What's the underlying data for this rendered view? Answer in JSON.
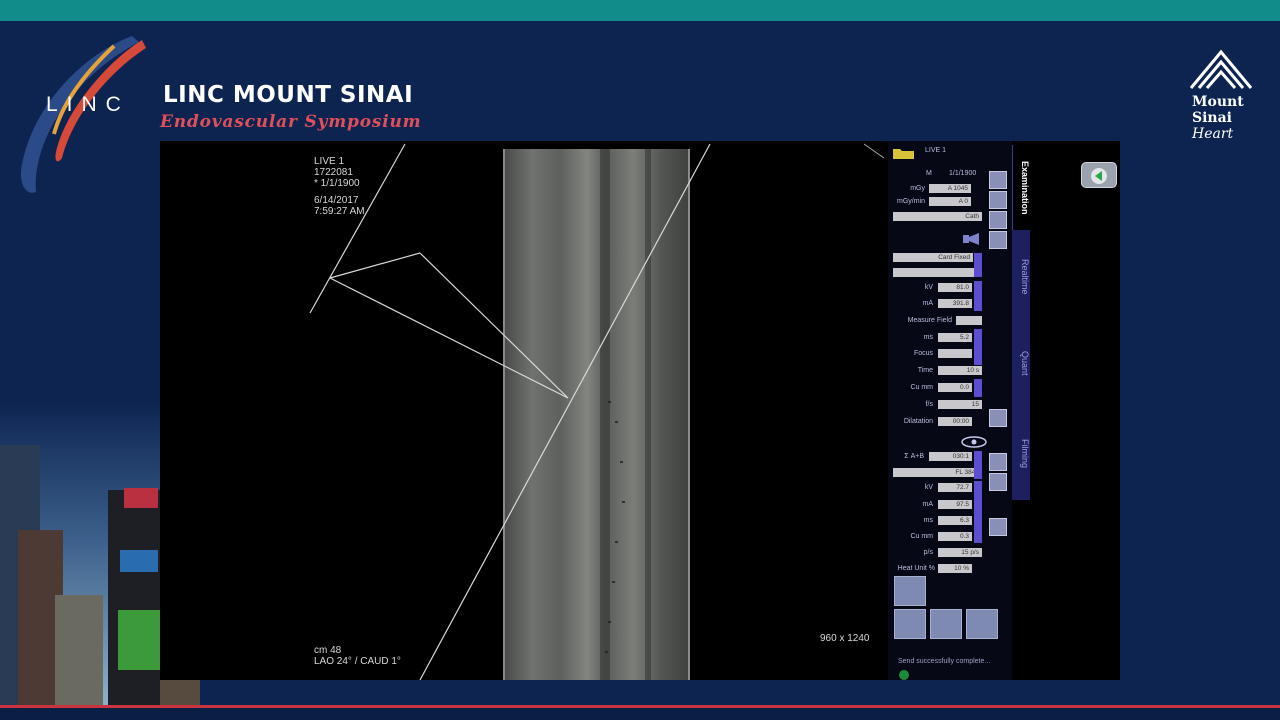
{
  "header": {
    "logo_text": "LINC",
    "title": "LINC MOUNT SINAI",
    "subtitle": "Endovascular Symposium",
    "partner_name_line1": "Mount",
    "partner_name_line2": "Sinai",
    "partner_name_line3": "Heart"
  },
  "viewer": {
    "overlay_top": [
      "LIVE 1",
      "1722081",
      "* 1/1/1900"
    ],
    "date": "6/14/2017",
    "time": "7:59:27 AM",
    "overlay_bottom": [
      "cm 48",
      "LAO 24° / CAUD 1°"
    ],
    "resolution": "960 x 1240"
  },
  "panel": {
    "live_label": "LIVE 1",
    "sex": "M",
    "dob": "1/1/1900",
    "mgy_label": "mGy",
    "mgy_value": "A 1045",
    "mgymin_label": "mGy/min",
    "mgymin_value": "A 0",
    "mode_select": "Cath",
    "card_select": "Card Fixed",
    "blank_select": "",
    "kv_label": "kV",
    "kv_value": "81.0",
    "ma_label": "mA",
    "ma_value": "391.8",
    "measure_field_label": "Measure Field",
    "ms_label": "ms",
    "ms_value": "5.2",
    "focus_label": "Focus",
    "time_label": "Time",
    "time_value": "10 s",
    "cumm_label": "Cu mm",
    "cumm_value": "0.0",
    "fs_label": "f/s",
    "fs_value": "15",
    "dilatation_label": "Dilatation",
    "dilatation_value": "00:00",
    "sigma_label": "Σ  A+B",
    "sigma_value": "030:1",
    "fl_select": "FL 3840",
    "kv2_label": "kV",
    "kv2_value": "72.7",
    "ma2_label": "mA",
    "ma2_value": "97.5",
    "ms2_label": "ms",
    "ms2_value": "6.3",
    "cumm2_label": "Cu mm",
    "cumm2_value": "0.3",
    "ps_label": "p/s",
    "ps_value": "15 p/s",
    "heat_label": "Heat Unit %",
    "heat_value": "10 %",
    "status_text": "Send successfully complete..."
  },
  "tabs": [
    "Examination",
    "Realtime",
    "Quant",
    "Filming"
  ],
  "colors": {
    "background": "#0d2350",
    "teal_stripe": "#118c8b",
    "accent_red": "#c9343e",
    "subtitle_red": "#e0505a",
    "panel_slider": "#5b4fcf"
  }
}
